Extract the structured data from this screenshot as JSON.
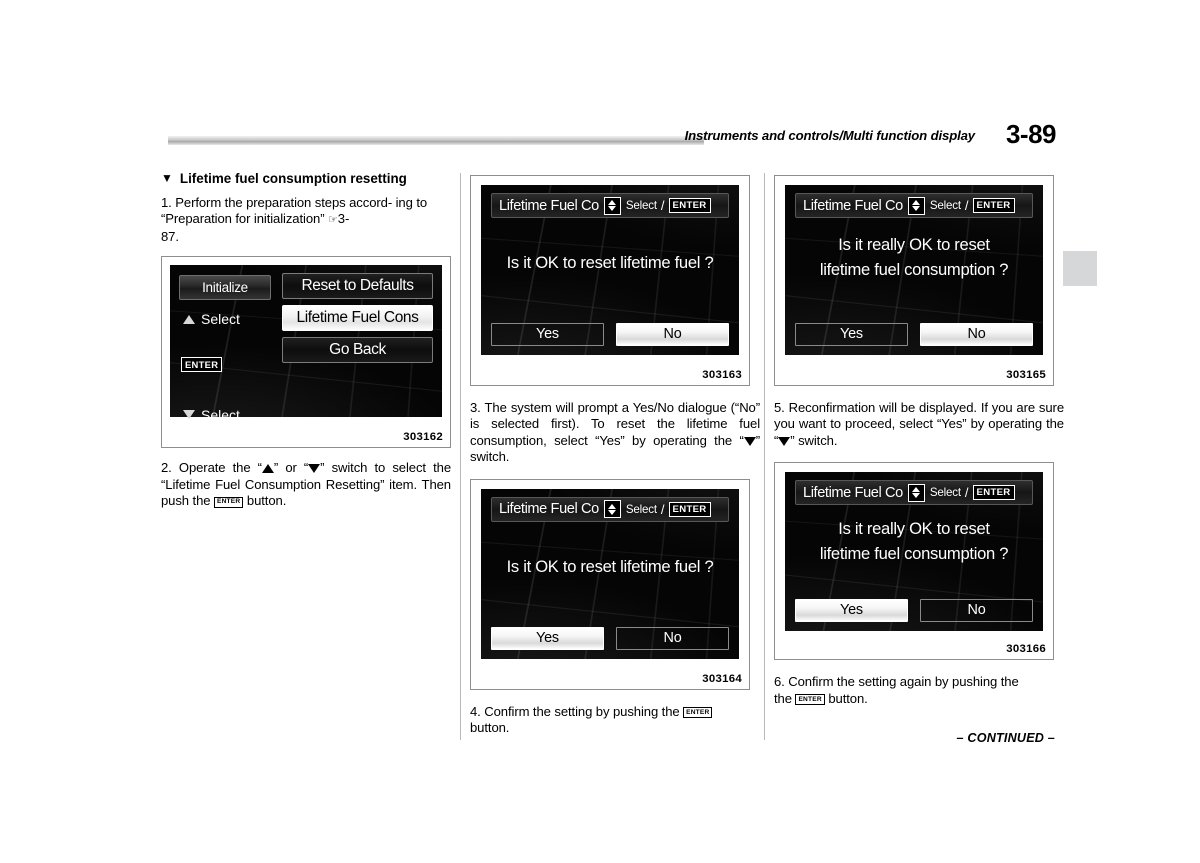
{
  "header": {
    "title": "Instruments and controls/Multi function display",
    "page_number": "3-89"
  },
  "footer": {
    "continued": "– CONTINUED –"
  },
  "column1": {
    "section_heading": "Lifetime fuel consumption resetting",
    "section_marker": "▼",
    "step1_a": "1. Perform the preparation steps accord-",
    "step1_b": "ing to “Preparation for initialization”",
    "step1_ref": "3-",
    "step1_c": "87.",
    "step2_a": "2. Operate the “",
    "step2_b": "” or “",
    "step2_c": "” switch to select the “Lifetime Fuel Consumption Resetting” item. Then push the",
    "step2_enter": "ENTER",
    "step2_d": "button."
  },
  "column2": {
    "step3": "3. The system will prompt a Yes/No dialogue (“No” is selected first). To reset the lifetime fuel consumption, select “Yes” by operating the “",
    "step3_end": "” switch.",
    "step4_a": "4.  Confirm the setting by pushing the",
    "step4_enter": "ENTER",
    "step4_b": "button."
  },
  "column3": {
    "step5": "5. Reconfirmation will be displayed. If you are sure you want to proceed, select “Yes” by operating the “",
    "step5_end": "” switch.",
    "step6_a": "6.  Confirm the setting again by pushing the",
    "step6_enter": "ENTER",
    "step6_b": "button."
  },
  "figures": {
    "fig_menu": {
      "caption": "303162",
      "left_panel": {
        "title": "Initialize",
        "select_up": "Select",
        "select_down": "Select",
        "enter": "ENTER"
      },
      "menu_items": [
        {
          "label": "Reset to Defaults",
          "selected": false
        },
        {
          "label": "Lifetime Fuel Cons",
          "selected": true
        },
        {
          "label": "Go Back",
          "selected": false
        }
      ]
    },
    "fig_confirm_no": {
      "caption": "303163",
      "title": "Lifetime Fuel Co",
      "select_label": "Select",
      "slash": "/",
      "enter": "ENTER",
      "message_line1": "Is it OK to reset lifetime fuel ?",
      "message_line2": "",
      "buttons": [
        {
          "label": "Yes",
          "selected": false
        },
        {
          "label": "No",
          "selected": true
        }
      ]
    },
    "fig_confirm_yes": {
      "caption": "303164",
      "title": "Lifetime Fuel Co",
      "select_label": "Select",
      "slash": "/",
      "enter": "ENTER",
      "message_line1": "Is it OK to reset lifetime fuel ?",
      "message_line2": "",
      "buttons": [
        {
          "label": "Yes",
          "selected": true
        },
        {
          "label": "No",
          "selected": false
        }
      ]
    },
    "fig_reconfirm_no": {
      "caption": "303165",
      "title": "Lifetime Fuel Co",
      "select_label": "Select",
      "slash": "/",
      "enter": "ENTER",
      "message_line1": "Is it really OK to reset",
      "message_line2": "lifetime fuel consumption ?",
      "buttons": [
        {
          "label": "Yes",
          "selected": false
        },
        {
          "label": "No",
          "selected": true
        }
      ]
    },
    "fig_reconfirm_yes": {
      "caption": "303166",
      "title": "Lifetime Fuel Co",
      "select_label": "Select",
      "slash": "/",
      "enter": "ENTER",
      "message_line1": "Is it really OK to reset",
      "message_line2": "lifetime fuel consumption ?",
      "buttons": [
        {
          "label": "Yes",
          "selected": true
        },
        {
          "label": "No",
          "selected": false
        }
      ]
    }
  },
  "colors": {
    "page_background": "#ffffff",
    "text": "#000000",
    "rule_gray": "#c8c8c8",
    "tab_gray": "#d6d7d9",
    "screen_black": "#050505",
    "highlight_white": "#ffffff"
  }
}
